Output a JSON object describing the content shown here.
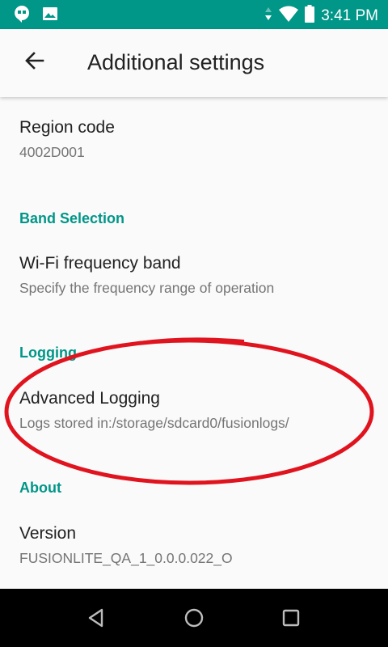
{
  "status_bar": {
    "time": "3:41 PM",
    "icons": [
      "hangouts-icon",
      "image-icon",
      "data-arrows-icon",
      "wifi-icon",
      "battery-icon"
    ]
  },
  "app_bar": {
    "title": "Additional settings",
    "back_icon": "arrow-back-icon"
  },
  "items": {
    "region": {
      "title": "Region code",
      "summary": "4002D001"
    },
    "band_category": "Band Selection",
    "wifi_band": {
      "title": "Wi-Fi frequency band",
      "summary": "Specify the frequency range of operation"
    },
    "logging_category": "Logging",
    "advanced_logging": {
      "title": "Advanced Logging",
      "summary": "Logs stored in:/storage/sdcard0/fusionlogs/"
    },
    "about_category": "About",
    "version": {
      "title": "Version",
      "summary": "FUSIONLITE_QA_1_0.0.0.022_O"
    }
  },
  "annotation": {
    "color": "#e0141e",
    "shape": "ellipse"
  },
  "colors": {
    "accent": "#009688",
    "status_bar": "#009688",
    "nav_bar": "#000000"
  },
  "nav_bar": {
    "icons": [
      "back-triangle-icon",
      "home-circle-icon",
      "recents-square-icon"
    ]
  }
}
